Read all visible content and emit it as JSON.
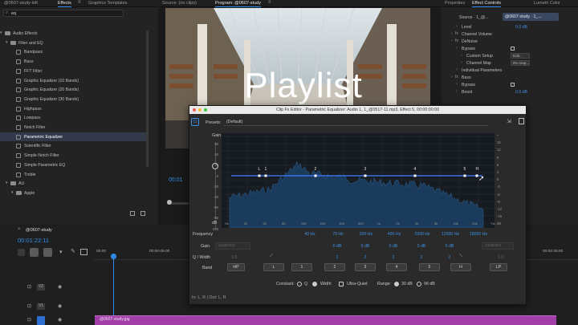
{
  "left_panel": {
    "tabs": [
      "@0607-study-left",
      "Effects",
      "Graphics Templates"
    ],
    "search_value": "eq",
    "tree": [
      {
        "label": "Audio Effects",
        "indent": 0,
        "folder": true
      },
      {
        "label": "Filter and EQ",
        "indent": 1,
        "folder": true
      },
      {
        "label": "Bandpass",
        "indent": 2
      },
      {
        "label": "Bass",
        "indent": 2
      },
      {
        "label": "FFT Filter",
        "indent": 2
      },
      {
        "label": "Graphic Equalizer (10 Bands)",
        "indent": 2
      },
      {
        "label": "Graphic Equalizer (20 Bands)",
        "indent": 2
      },
      {
        "label": "Graphic Equalizer (30 Bands)",
        "indent": 2
      },
      {
        "label": "Highpass",
        "indent": 2
      },
      {
        "label": "Lowpass",
        "indent": 2
      },
      {
        "label": "Notch Filter",
        "indent": 2
      },
      {
        "label": "Parametric Equalizer",
        "indent": 2,
        "selected": true
      },
      {
        "label": "Scientific Filter",
        "indent": 2
      },
      {
        "label": "Simple Notch Filter",
        "indent": 2
      },
      {
        "label": "Simple Parametric EQ",
        "indent": 2
      },
      {
        "label": "Treble",
        "indent": 2
      },
      {
        "label": "AU",
        "indent": 1,
        "folder": true
      },
      {
        "label": "Apple",
        "indent": 2,
        "folder": true
      }
    ]
  },
  "source_tab": "Source: (no clips)",
  "program_tab": "Program: @0607-study",
  "program_timecode": "00:01",
  "video_title_text": "Playlist",
  "right_panel": {
    "tabs": [
      "Properties",
      "Effect Controls",
      "Lumetri Color"
    ],
    "source_clip": "Source · 1_@...",
    "sequence_clip": "@0607-study · 1_...",
    "rows": [
      {
        "label": "Level",
        "indent": 2,
        "value": "0.0 dB"
      },
      {
        "label": "Channel Volume",
        "indent": 1,
        "fx": true
      },
      {
        "label": "DeNoise",
        "indent": 1,
        "fx": true
      },
      {
        "label": "Bypass",
        "indent": 2,
        "checkbox": true
      },
      {
        "label": "Custom Setup",
        "indent": 3,
        "button": "Edit..."
      },
      {
        "label": "Channel Map",
        "indent": 3,
        "button": "Re-map..."
      },
      {
        "label": "Individual Parameters",
        "indent": 2
      },
      {
        "label": "Bass",
        "indent": 1,
        "fx": true
      },
      {
        "label": "Bypass",
        "indent": 2,
        "checkbox": true
      },
      {
        "label": "Boost",
        "indent": 2,
        "value": "0.0 dB"
      }
    ]
  },
  "timeline": {
    "name": "@0607-study",
    "timecode": "00:01:22:11",
    "ruler_labels": [
      "00:00",
      "00:00:05:00",
      "00:00:10:00",
      "00:00:35:00"
    ],
    "tracks": [
      "V2",
      "V1",
      "A1"
    ],
    "clip_label": "@0607-study.jpg"
  },
  "eq": {
    "title": "Clip Fx Editor - Parametric Equalizer: Audio 1, 1_@0517-11.mp3, Effect 5, 00:00:00:00",
    "presets_label": "Presets:",
    "preset_value": "(Default)",
    "gain_label": "Gain",
    "db_scale": [
      "+",
      "15",
      "12",
      "9",
      "6",
      "3",
      "0",
      "-3",
      "-6",
      "-9",
      "-12",
      "-15",
      "dB"
    ],
    "left_scale": [
      "60",
      "40",
      "20",
      "0",
      "-20",
      "-40",
      "-60",
      "-80",
      "-100"
    ],
    "left_scale_unit": "dB",
    "freq_scale": [
      "Hz",
      "20",
      "40",
      "60",
      "100",
      "200",
      "300",
      "500",
      "1k",
      "2k",
      "3k",
      "5k",
      "10k",
      "20k",
      "Hz"
    ],
    "node_labels": [
      "L",
      "1",
      "2",
      "3",
      "4",
      "5",
      "H"
    ],
    "frequency_label": "Frequency",
    "gain_row_label": "Gain",
    "q_row_label": "Q / Width",
    "band_label": "Band",
    "frequencies": [
      "40 Hz",
      "70 Hz",
      "200 Hz",
      "400 Hz",
      "3200 Hz",
      "12000 Hz",
      "18000 Hz"
    ],
    "gain_hidden": [
      "24dB/Oct",
      "24dB/Oct"
    ],
    "gains": [
      "0 dB",
      "0 dB",
      "0 dB",
      "0 dB",
      "0 dB"
    ],
    "q_values": [
      "2",
      "2",
      "2",
      "2",
      "2"
    ],
    "q_far": [
      "1.0",
      "1.0"
    ],
    "bands": [
      "HP",
      "L",
      "1",
      "2",
      "3",
      "4",
      "5",
      "H",
      "LP"
    ],
    "constant_label": "Constant:",
    "constant_options": [
      "Q",
      "Width"
    ],
    "constant_selected": "Width",
    "ultra_quiet_label": "Ultra-Quiet",
    "range_label": "Range:",
    "range_options": [
      "30 dB",
      "96 dB"
    ],
    "range_selected": "30 dB",
    "io_label": "In: L, R | Out: L, R"
  }
}
